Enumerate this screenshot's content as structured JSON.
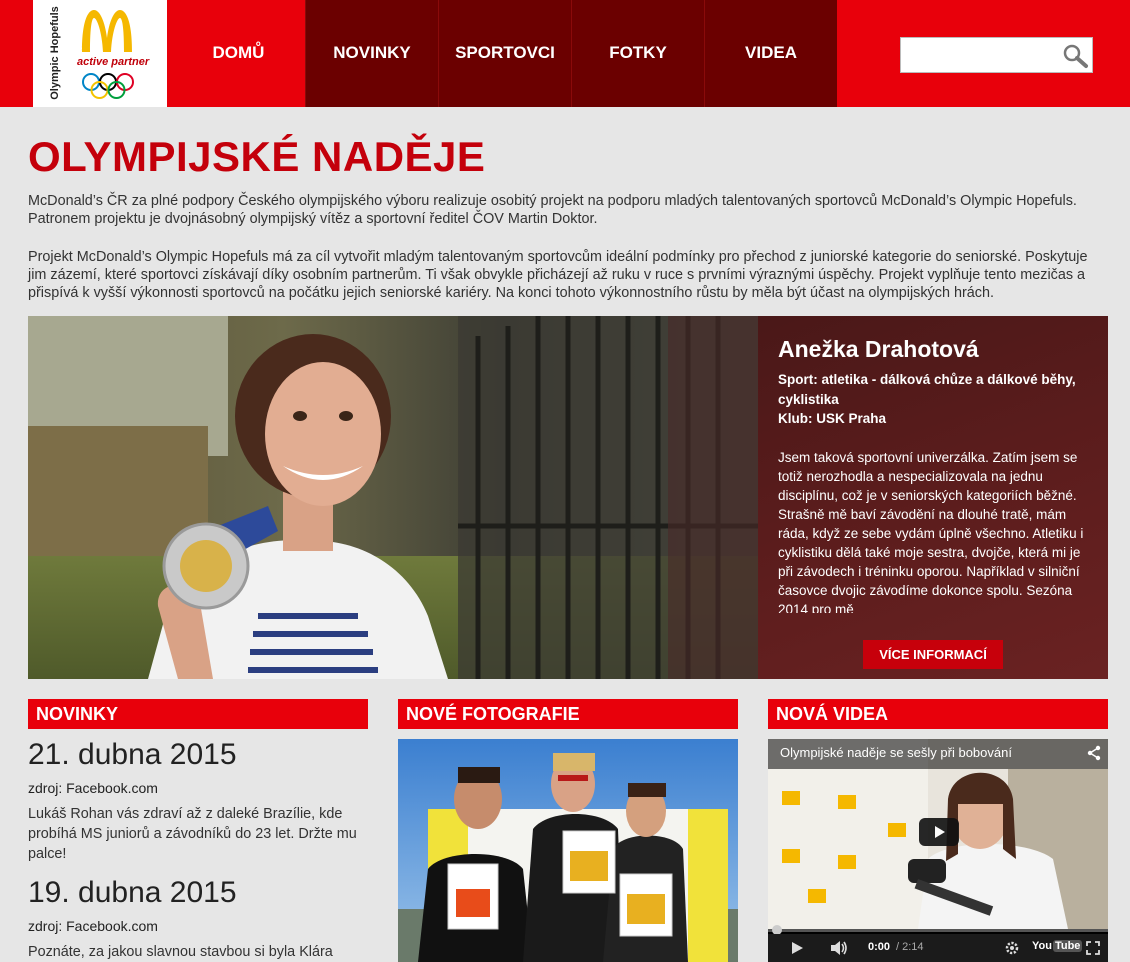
{
  "logo": {
    "vertical_text": "Olympic Hopefuls",
    "partner_text": "active partner"
  },
  "nav": {
    "items": [
      "DOMŮ",
      "NOVINKY",
      "SPORTOVCI",
      "FOTKY",
      "VIDEA"
    ]
  },
  "search": {
    "value": "",
    "placeholder": ""
  },
  "page": {
    "title": "OLYMPIJSKÉ NADĚJE",
    "intro_p1": "McDonald’s ČR za plné podpory Českého olympijského výboru realizuje osobitý projekt na podporu mladých talentovaných sportovců McDonald’s Olympic Hopefuls. Patronem projektu je dvojnásobný olympijský vítěz a sportovní ředitel ČOV Martin Doktor.",
    "intro_p2": "Projekt McDonald’s Olympic Hopefuls má za cíl vytvořit mladým talentovaným sportovcům ideální podmínky pro přechod z juniorské kategorie do seniorské. Poskytuje jim zázemí, které sportovci získávají díky osobním partnerům. Ti však obvykle přicházejí až ruku v ruce s prvními výraznými úspěchy. Projekt vyplňuje tento mezičas a přispívá k vyšší výkonnosti sportovců na počátku jejich seniorské kariéry. Na konci tohoto výkonnostního růstu by měla být účast na olympijských hrách."
  },
  "hero": {
    "name": "Anežka Drahotová",
    "sport": "Sport: atletika - dálková chůze a dálkové běhy, cyklistika",
    "club": "Klub: USK Praha",
    "text": "Jsem taková sportovní univerzálka. Zatím jsem se totiž nerozhodla a nespecializovala na jednu disciplínu, což je v seniorských kategoriích běžné. Strašně mě baví závodění na dlouhé tratě, mám ráda, když ze sebe vydám úplně všechno. Atletiku i cyklistiku dělá také moje sestra, dvojče, která mi je při závodech i tréninku oporou. Například v silniční časovce dvojic závodíme dokonce spolu. Sezóna 2014 pro mě",
    "button": "VÍCE INFORMACÍ"
  },
  "sections": {
    "news": "NOVINKY",
    "photos": "NOVÉ FOTOGRAFIE",
    "videos": "NOVÁ VIDEA"
  },
  "news": [
    {
      "date": "21. dubna 2015",
      "source": "zdroj: Facebook.com",
      "text": "Lukáš Rohan vás zdraví až z daleké Brazílie, kde probíhá MS juniorů a závodníků do 23 let. Držte mu palce!"
    },
    {
      "date": "19. dubna 2015",
      "source": "zdroj: Facebook.com",
      "text": "Poznáte, za jakou slavnou stavbou si byla Klára"
    }
  ],
  "video": {
    "title": "Olympijské naděje se sešly při bobování",
    "time_current": "0:00",
    "time_total": "/ 2:14",
    "yt_you": "You",
    "yt_tube": "Tube"
  },
  "colors": {
    "brand_red": "#e8000b",
    "dark_red": "#6b0000",
    "title_red": "#c4000b"
  }
}
